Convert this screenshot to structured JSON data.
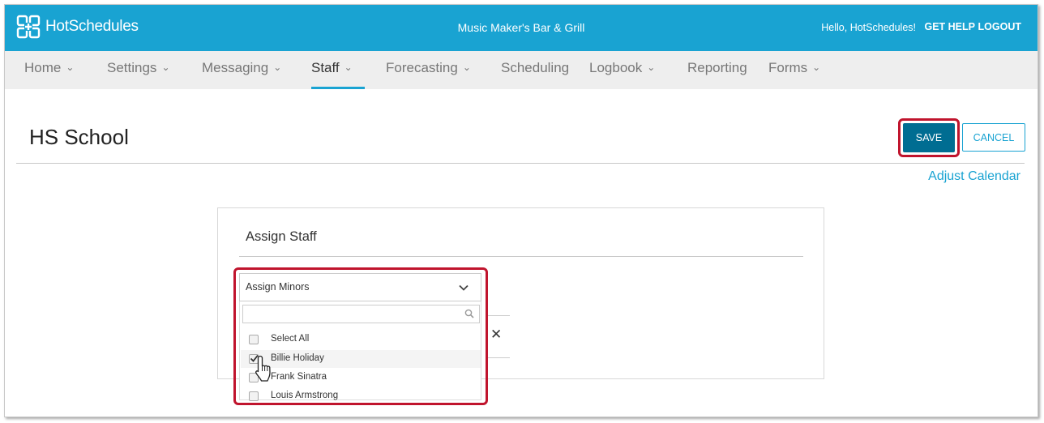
{
  "brand": {
    "name": "HotSchedules",
    "accent": "#19a3d2",
    "highlight": "#c0142d",
    "save_bg": "#006d92"
  },
  "header": {
    "store_name": "Music Maker's Bar & Grill",
    "greeting": "Hello, HotSchedules!",
    "get_help": "GET HELP",
    "logout": "LOGOUT"
  },
  "nav": {
    "items": [
      {
        "label": "Home",
        "chevron": true
      },
      {
        "label": "Settings",
        "chevron": true
      },
      {
        "label": "Messaging",
        "chevron": true
      },
      {
        "label": "Staff",
        "chevron": true,
        "active": true
      },
      {
        "label": "Forecasting",
        "chevron": true
      },
      {
        "label": "Scheduling",
        "chevron": false
      },
      {
        "label": "Logbook",
        "chevron": true
      },
      {
        "label": "Reporting",
        "chevron": false
      },
      {
        "label": "Forms",
        "chevron": true
      }
    ]
  },
  "page": {
    "title": "HS School",
    "save_label": "SAVE",
    "cancel_label": "CANCEL",
    "adjust_calendar": "Adjust Calendar"
  },
  "card": {
    "title": "Assign Staff",
    "dropdown": {
      "selected": "Assign Minors",
      "search_placeholder": "",
      "options": [
        {
          "label": "Select All",
          "checked": false
        },
        {
          "label": "Billie Holiday",
          "checked": true
        },
        {
          "label": "Frank Sinatra",
          "checked": false
        },
        {
          "label": "Louis Armstrong",
          "checked": false
        }
      ]
    }
  },
  "icons": {
    "logo": "hotschedules-logo-icon",
    "nav_chevron": "chevron-down-icon",
    "dropdown_chevron": "chevron-down-icon",
    "search": "search-icon",
    "remove": "close-icon",
    "cursor": "mouse-pointer-icon"
  }
}
